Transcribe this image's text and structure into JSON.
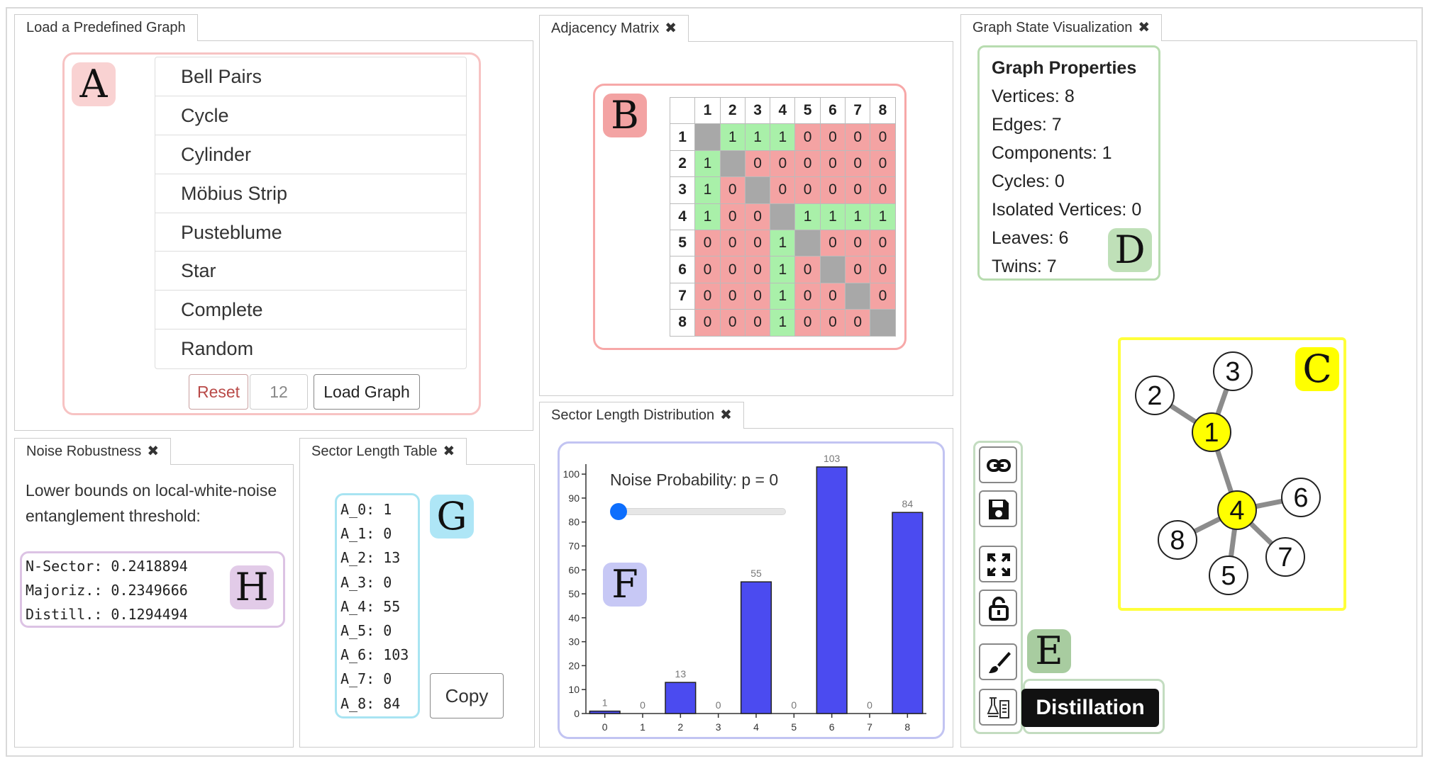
{
  "predefined": {
    "tab": "Load a Predefined Graph",
    "marker": "A",
    "graphs": [
      "Bell Pairs",
      "Cycle",
      "Cylinder",
      "Möbius Strip",
      "Pusteblume",
      "Star",
      "Complete",
      "Random"
    ],
    "reset_label": "Reset",
    "size_value": "12",
    "load_label": "Load Graph",
    "reset_color": "#b94a48"
  },
  "adjacency": {
    "tab": "Adjacency Matrix",
    "marker": "B",
    "headers": [
      "1",
      "2",
      "3",
      "4",
      "5",
      "6",
      "7",
      "8"
    ],
    "rows": [
      [
        "",
        "1",
        "1",
        "1",
        "0",
        "0",
        "0",
        "0"
      ],
      [
        "1",
        "",
        "0",
        "0",
        "0",
        "0",
        "0",
        "0"
      ],
      [
        "1",
        "0",
        "",
        "0",
        "0",
        "0",
        "0",
        "0"
      ],
      [
        "1",
        "0",
        "0",
        "",
        "1",
        "1",
        "1",
        "1"
      ],
      [
        "0",
        "0",
        "0",
        "1",
        "",
        "0",
        "0",
        "0"
      ],
      [
        "0",
        "0",
        "0",
        "1",
        "0",
        "",
        "0",
        "0"
      ],
      [
        "0",
        "0",
        "0",
        "1",
        "0",
        "0",
        "",
        "0"
      ],
      [
        "0",
        "0",
        "0",
        "1",
        "0",
        "0",
        "0",
        ""
      ]
    ],
    "colors": {
      "one": "#a9f0a9",
      "zero": "#f4a3a3",
      "diagonal": "#a8a8a8"
    }
  },
  "graph_state": {
    "tab": "Graph State Visualization",
    "properties_title": "Graph Properties",
    "properties": [
      "Vertices: 8",
      "Edges: 7",
      "Components: 1",
      "Cycles: 0",
      "Isolated Vertices: 0",
      "Leaves: 6",
      "Twins: 7"
    ],
    "marker_props": "D",
    "marker_graph": "C",
    "marker_tools": "E",
    "nodes": [
      {
        "label": "1",
        "highlight": true
      },
      {
        "label": "2",
        "highlight": false
      },
      {
        "label": "3",
        "highlight": false
      },
      {
        "label": "4",
        "highlight": true
      },
      {
        "label": "5",
        "highlight": false
      },
      {
        "label": "6",
        "highlight": false
      },
      {
        "label": "7",
        "highlight": false
      },
      {
        "label": "8",
        "highlight": false
      }
    ],
    "edges": [
      [
        "1",
        "2"
      ],
      [
        "1",
        "3"
      ],
      [
        "1",
        "4"
      ],
      [
        "4",
        "5"
      ],
      [
        "4",
        "6"
      ],
      [
        "4",
        "7"
      ],
      [
        "4",
        "8"
      ]
    ],
    "tools": [
      "link-icon",
      "save-icon",
      "fullscreen-icon",
      "unlock-icon",
      "brush-icon",
      "distillation-icon"
    ],
    "tooltip": "Distillation",
    "highlight_color": "#ffff00"
  },
  "noise": {
    "tab": "Noise Robustness",
    "description_line1": "Lower bounds on local-white-noise",
    "description_line2": "entanglement threshold:",
    "marker": "H",
    "lines": [
      "N-Sector: 0.2418894",
      "Majoriz.: 0.2349666",
      "Distill.: 0.1294494"
    ]
  },
  "sector_table": {
    "tab": "Sector Length Table",
    "marker": "G",
    "lines": [
      "A_0: 1",
      "A_1: 0",
      "A_2: 13",
      "A_3: 0",
      "A_4: 55",
      "A_5: 0",
      "A_6: 103",
      "A_7: 0",
      "A_8: 84"
    ],
    "copy_label": "Copy"
  },
  "sector_distribution": {
    "tab": "Sector Length Distribution",
    "marker": "F",
    "slider_label": "Noise Probability: p = 0",
    "slider_value": 0
  },
  "chart_data": {
    "type": "bar",
    "categories": [
      "0",
      "1",
      "2",
      "3",
      "4",
      "5",
      "6",
      "7",
      "8"
    ],
    "values": [
      1,
      0,
      13,
      0,
      55,
      0,
      103,
      0,
      84
    ],
    "yticks": [
      0,
      10,
      20,
      30,
      40,
      50,
      60,
      70,
      80,
      90,
      100
    ],
    "ylim": [
      0,
      103
    ],
    "bar_color": "#4b4bf0"
  }
}
